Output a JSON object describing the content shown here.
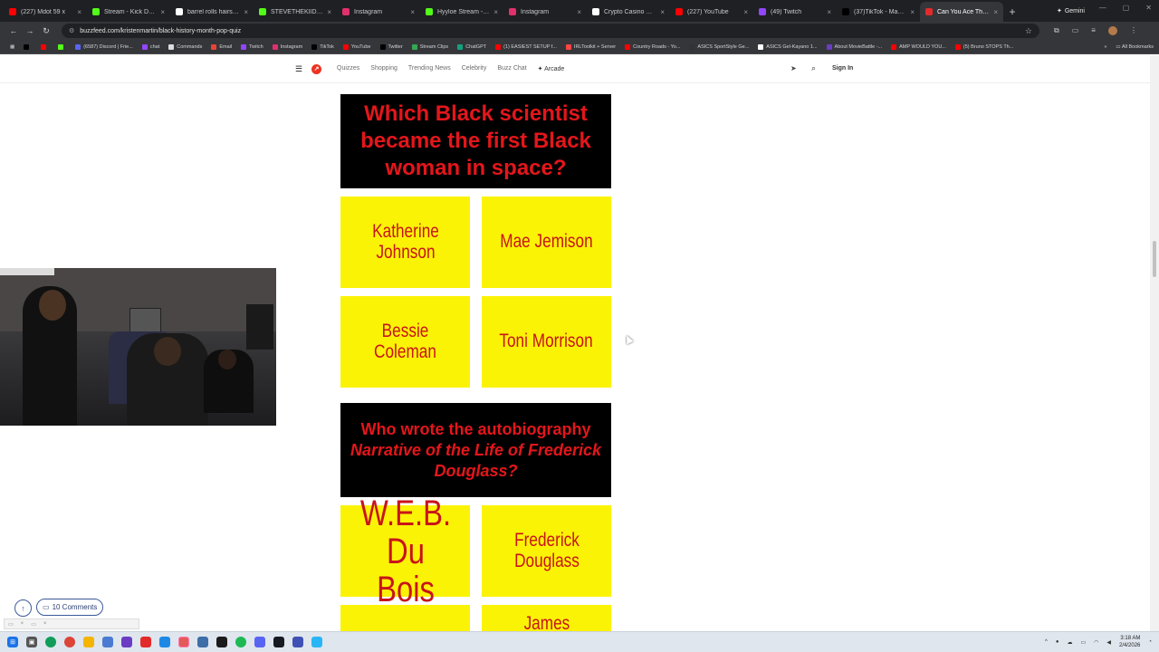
{
  "browser": {
    "tabs": [
      {
        "title": "(227) Mdot 59 x",
        "color": "#ff0000",
        "active": false
      },
      {
        "title": "Stream - Kick Dashb",
        "color": "#53fc18",
        "active": false
      },
      {
        "title": "barrel rolls hairstyle",
        "color": "#ffffff",
        "active": false
      },
      {
        "title": "STEVETHEKIID Stream",
        "color": "#53fc18",
        "active": false
      },
      {
        "title": "Instagram",
        "color": "#e1306c",
        "active": false
      },
      {
        "title": "Hyyloe Stream - Wat",
        "color": "#53fc18",
        "active": false
      },
      {
        "title": "Instagram",
        "color": "#e1306c",
        "active": false
      },
      {
        "title": "Crypto Casino Onlin",
        "color": "#ffffff",
        "active": false
      },
      {
        "title": "(227) YouTube",
        "color": "#ff0000",
        "active": false
      },
      {
        "title": "(49) Twitch",
        "color": "#9146ff",
        "active": false
      },
      {
        "title": "(37)TikTok - Make Yo",
        "color": "#000000",
        "active": false
      },
      {
        "title": "Can You Ace This Bla",
        "color": "#e32a2a",
        "active": true
      }
    ],
    "new_tab": "+",
    "gemini_label": "Gemini",
    "url": "buzzfeed.com/kristenmartin/black-history-month-pop-quiz",
    "bookmarks": [
      {
        "label": "",
        "color": "#000000"
      },
      {
        "label": "",
        "color": "#ff0000"
      },
      {
        "label": "",
        "color": "#53fc18"
      },
      {
        "label": "(6587) Discord | Frie...",
        "color": "#5865f2"
      },
      {
        "label": "chat",
        "color": "#9146ff"
      },
      {
        "label": "Commands",
        "color": "#dddddd"
      },
      {
        "label": "Email",
        "color": "#ea4335"
      },
      {
        "label": "Twitch",
        "color": "#9146ff"
      },
      {
        "label": "Instagram",
        "color": "#e1306c"
      },
      {
        "label": "TikTok",
        "color": "#000000"
      },
      {
        "label": "YouTube",
        "color": "#ff0000"
      },
      {
        "label": "Twitter",
        "color": "#000000"
      },
      {
        "label": "Stream Clips",
        "color": "#34a853"
      },
      {
        "label": "ChatGPT",
        "color": "#10a37f"
      },
      {
        "label": "(1) EASIEST SETUP f...",
        "color": "#ff0000"
      },
      {
        "label": "IRLToolkit + Server",
        "color": "#ff4444"
      },
      {
        "label": "Country Roads - Yo...",
        "color": "#ff0000"
      },
      {
        "label": "ASICS SportStyle Ge...",
        "color": "#333333"
      },
      {
        "label": "ASICS Gel-Kayano 1...",
        "color": "#ffffff"
      },
      {
        "label": "About MovieBattle -...",
        "color": "#6a3dc4"
      },
      {
        "label": "AMP WOULD YOU...",
        "color": "#ff0000"
      },
      {
        "label": "(5) Bruno STOPS Th...",
        "color": "#ff0000"
      }
    ],
    "all_bookmarks": "All Bookmarks"
  },
  "site_nav": {
    "links": [
      "Quizzes",
      "Shopping",
      "Trending News",
      "Celebrity",
      "Buzz Chat"
    ],
    "arcade": "✦ Arcade",
    "signin": "Sign In"
  },
  "quiz": {
    "q1": {
      "question": "Which Black scientist became the first Black woman in space?",
      "answers": [
        "Katherine Johnson",
        "Mae Jemison",
        "Bessie Coleman",
        "Toni Morrison"
      ]
    },
    "q2": {
      "question_prefix": "Who wrote the autobiography",
      "question_title": "Narrative of the Life of Frederick Douglass?",
      "answers": [
        "W.E.B. Du Bois",
        "Frederick Douglass",
        "",
        "James"
      ]
    }
  },
  "floating": {
    "comments_label": "10 Comments"
  },
  "taskbar": {
    "time": "3:18 AM",
    "date": "2/4/2026"
  }
}
